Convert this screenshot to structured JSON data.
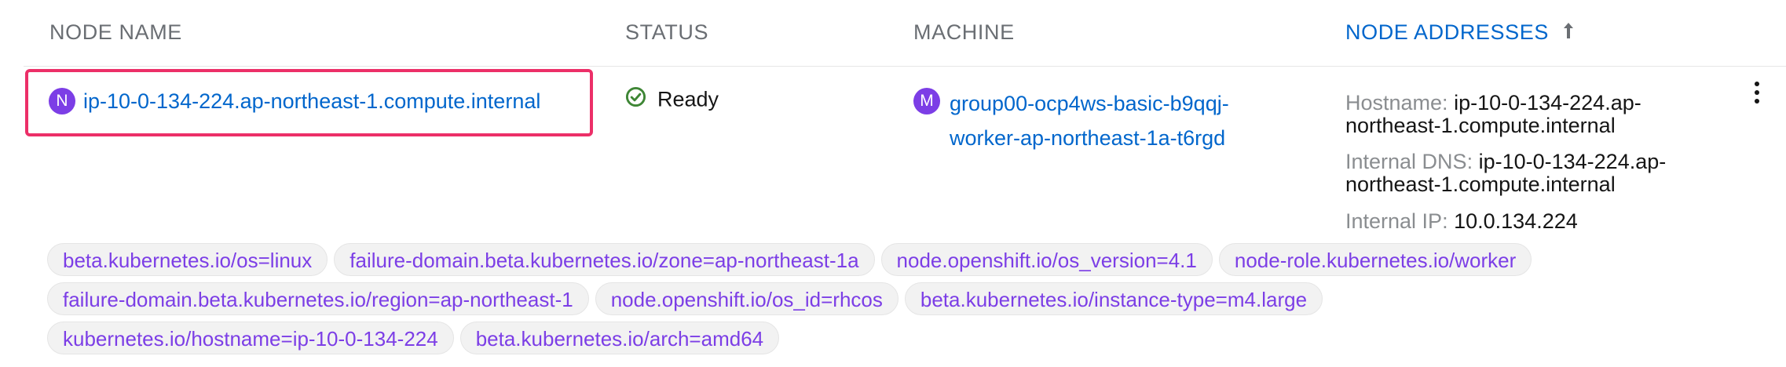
{
  "table": {
    "headers": {
      "node_name": "NODE NAME",
      "status": "STATUS",
      "machine": "MACHINE",
      "node_addresses": "NODE ADDRESSES"
    },
    "sorted_column": "node_addresses",
    "sort_direction": "ascending",
    "row": {
      "node": {
        "badge": "N",
        "name": "ip-10-0-134-224.ap-northeast-1.compute.internal"
      },
      "status": {
        "icon": "check-circle-icon",
        "text": "Ready",
        "color": "#3e8635"
      },
      "machine": {
        "badge": "M",
        "line1": "group00-ocp4ws-basic-b9qqj-",
        "line2": "worker-ap-northeast-1a-t6rgd"
      },
      "addresses": {
        "hostname_label": "Hostname:",
        "hostname_line1": "ip-10-0-134-224.ap-",
        "hostname_line2": "northeast-1.compute.internal",
        "dns_label": "Internal DNS:",
        "dns_line1": "ip-10-0-134-224.ap-",
        "dns_line2": "northeast-1.compute.internal",
        "ip_label": "Internal IP:",
        "ip_value": "10.0.134.224"
      },
      "labels": [
        [
          "beta.kubernetes.io/os=linux",
          "failure-domain.beta.kubernetes.io/zone=ap-northeast-1a",
          "node.openshift.io/os_version=4.1",
          "node-role.kubernetes.io/worker"
        ],
        [
          "failure-domain.beta.kubernetes.io/region=ap-northeast-1",
          "node.openshift.io/os_id=rhcos",
          "beta.kubernetes.io/instance-type=m4.large"
        ],
        [
          "kubernetes.io/hostname=ip-10-0-134-224",
          "beta.kubernetes.io/arch=amd64"
        ]
      ]
    }
  },
  "colors": {
    "link": "#0066cc",
    "badge": "#7c3ee6",
    "highlight_border": "#ec2f68",
    "header_text": "#6a6e73"
  }
}
